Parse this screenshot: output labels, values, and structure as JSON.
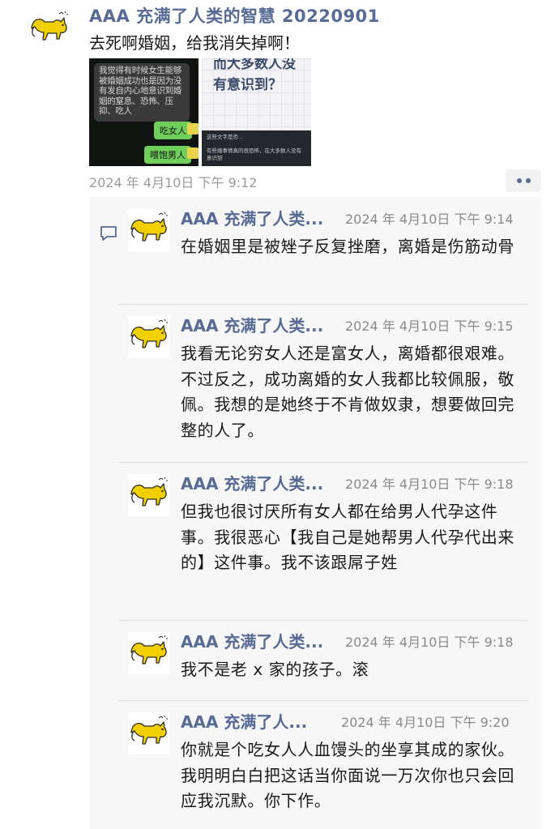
{
  "post": {
    "author": "AAA 充满了人类的智慧 20220901",
    "text": "去死啊婚姻，给我消失掉啊！",
    "time": "2024 年 4月10日 下午 9:12",
    "images": [
      {
        "chat_text": "我觉得有时候女生能够被婚姻成功也是因为没有发自内心地意识到婚姻的窒息、恐怖、压抑、吃人",
        "bubble_1": "吃女人",
        "bubble_2": "喂饱男人"
      },
      {
        "title": "而大多数人没有意识到？",
        "footer_head": "这些文字是否...",
        "footer_text": "有些婚事情真的很恐怖，在大多数人没有意识到"
      }
    ]
  },
  "comments": [
    {
      "author": "AAA 充满了人类...",
      "time": "2024 年 4月10日 下午 9:14",
      "text": "在婚姻里是被矬子反复挫磨，离婚是伤筋动骨"
    },
    {
      "author": "AAA 充满了人类...",
      "time": "2024 年 4月10日 下午 9:15",
      "text": "我看无论穷女人还是富女人，离婚都很艰难。不过反之，成功离婚的女人我都比较佩服，敬佩。我想的是她终于不肯做奴隶，想要做回完整的人了。"
    },
    {
      "author": "AAA 充满了人类...",
      "time": "2024 年 4月10日 下午 9:18",
      "text": "但我也很讨厌所有女人都在给男人代孕这件事。我很恶心【我自己是她帮男人代孕代出来的】这件事。我不该跟屌子姓"
    },
    {
      "author": "AAA 充满了人类...",
      "time": "2024 年 4月10日 下午 9:18",
      "text": "我不是老 x 家的孩子。滚"
    },
    {
      "author": "AAA 充满了人...",
      "time": "2024 年 4月10日 下午 9:20",
      "text": "你就是个吃女人人血馒头的坐享其成的家伙。我明明白白把这话当你面说一万次你也只会回应我沉默。你下作。"
    }
  ],
  "colors": {
    "author": "#576b95",
    "time": "#8a8a8a",
    "panel": "#f7f7f7",
    "avatar_cat": "#f2d000"
  },
  "icons": [
    "cat-avatar-icon",
    "comment-bubble-icon",
    "more-dots-icon"
  ]
}
